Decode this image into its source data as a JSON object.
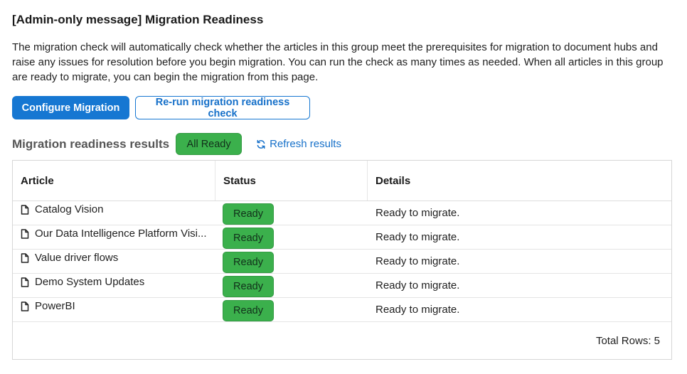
{
  "page": {
    "title": "[Admin-only message] Migration Readiness",
    "description": "The migration check will automatically check whether the articles in this group meet the prerequisites for migration to document hubs and raise any issues for resolution before you begin migration. You can run the check as many times as needed. When all articles in this group are ready to migrate, you can begin the migration from this page."
  },
  "buttons": {
    "configure_label": "Configure Migration",
    "rerun_label": "Re-run migration readiness check"
  },
  "results": {
    "title": "Migration readiness results",
    "overall_badge": "All Ready",
    "refresh_label": "Refresh results",
    "refresh_icon": "refresh-icon"
  },
  "table": {
    "columns": [
      "Article",
      "Status",
      "Details"
    ],
    "rows": [
      {
        "article": "Catalog Vision",
        "status": "Ready",
        "details": "Ready to migrate."
      },
      {
        "article": "Our Data Intelligence Platform Visi...",
        "status": "Ready",
        "details": "Ready to migrate."
      },
      {
        "article": "Value driver flows",
        "status": "Ready",
        "details": "Ready to migrate."
      },
      {
        "article": "Demo System Updates",
        "status": "Ready",
        "details": "Ready to migrate."
      },
      {
        "article": "PowerBI",
        "status": "Ready",
        "details": "Ready to migrate."
      }
    ],
    "total_rows_label": "Total Rows: 5",
    "row_icon": "document-icon"
  },
  "colors": {
    "primary": "#1677d2",
    "ready_green": "#3bb04c"
  }
}
